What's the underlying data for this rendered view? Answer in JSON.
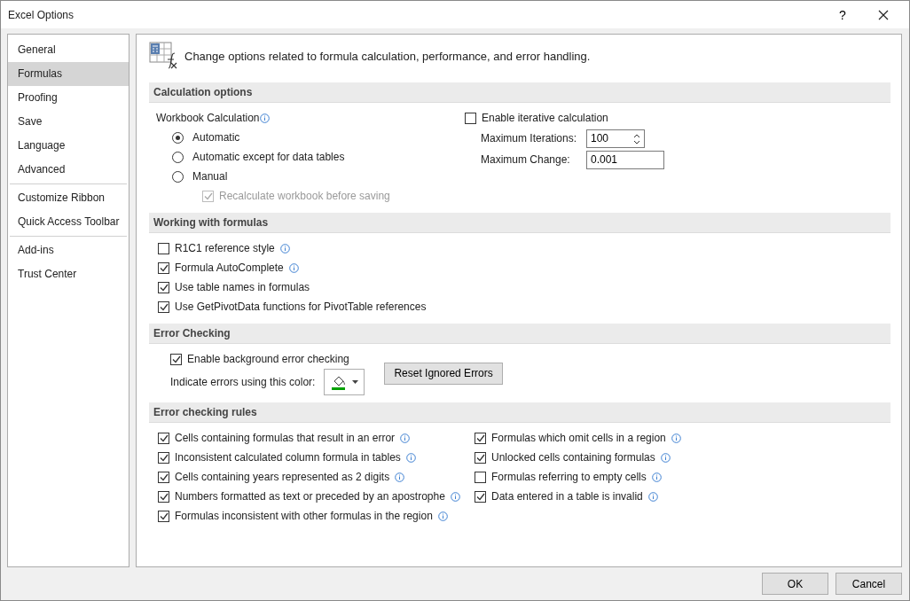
{
  "window": {
    "title": "Excel Options",
    "help": "?"
  },
  "sidebar": {
    "groups": [
      [
        {
          "label": "General",
          "selected": false
        },
        {
          "label": "Formulas",
          "selected": true
        },
        {
          "label": "Proofing",
          "selected": false
        },
        {
          "label": "Save",
          "selected": false
        },
        {
          "label": "Language",
          "selected": false
        },
        {
          "label": "Advanced",
          "selected": false
        }
      ],
      [
        {
          "label": "Customize Ribbon",
          "selected": false
        },
        {
          "label": "Quick Access Toolbar",
          "selected": false
        }
      ],
      [
        {
          "label": "Add-ins",
          "selected": false
        },
        {
          "label": "Trust Center",
          "selected": false
        }
      ]
    ]
  },
  "header": "Change options related to formula calculation, performance, and error handling.",
  "calculation": {
    "title": "Calculation options",
    "workbook_label": "Workbook Calculation",
    "radios": [
      {
        "label": "Automatic",
        "selected": true
      },
      {
        "label": "Automatic except for data tables",
        "selected": false
      },
      {
        "label": "Manual",
        "selected": false
      }
    ],
    "recalc": {
      "label": "Recalculate workbook before saving",
      "checked": true,
      "disabled": true
    },
    "iterative": {
      "label": "Enable iterative calculation",
      "checked": false
    },
    "max_iterations": {
      "label": "Maximum Iterations:",
      "value": "100"
    },
    "max_change": {
      "label": "Maximum Change:",
      "value": "0.001"
    }
  },
  "working": {
    "title": "Working with formulas",
    "options": [
      {
        "label": "R1C1 reference style",
        "checked": false,
        "info": true
      },
      {
        "label": "Formula AutoComplete",
        "checked": true,
        "info": true
      },
      {
        "label": "Use table names in formulas",
        "checked": true,
        "info": false
      },
      {
        "label": "Use GetPivotData functions for PivotTable references",
        "checked": true,
        "info": false
      }
    ]
  },
  "error_checking": {
    "title": "Error Checking",
    "background": {
      "label": "Enable background error checking",
      "checked": true
    },
    "color_label": "Indicate errors using this color:",
    "color": "#00a000",
    "reset_button": "Reset Ignored Errors"
  },
  "rules": {
    "title": "Error checking rules",
    "left": [
      {
        "label": "Cells containing formulas that result in an error",
        "checked": true
      },
      {
        "label": "Inconsistent calculated column formula in tables",
        "checked": true
      },
      {
        "label": "Cells containing years represented as 2 digits",
        "checked": true
      },
      {
        "label": "Numbers formatted as text or preceded by an apostrophe",
        "checked": true
      },
      {
        "label": "Formulas inconsistent with other formulas in the region",
        "checked": true
      }
    ],
    "right": [
      {
        "label": "Formulas which omit cells in a region",
        "checked": true
      },
      {
        "label": "Unlocked cells containing formulas",
        "checked": true
      },
      {
        "label": "Formulas referring to empty cells",
        "checked": false
      },
      {
        "label": "Data entered in a table is invalid",
        "checked": true
      }
    ]
  },
  "buttons": [
    "OK",
    "Cancel"
  ]
}
